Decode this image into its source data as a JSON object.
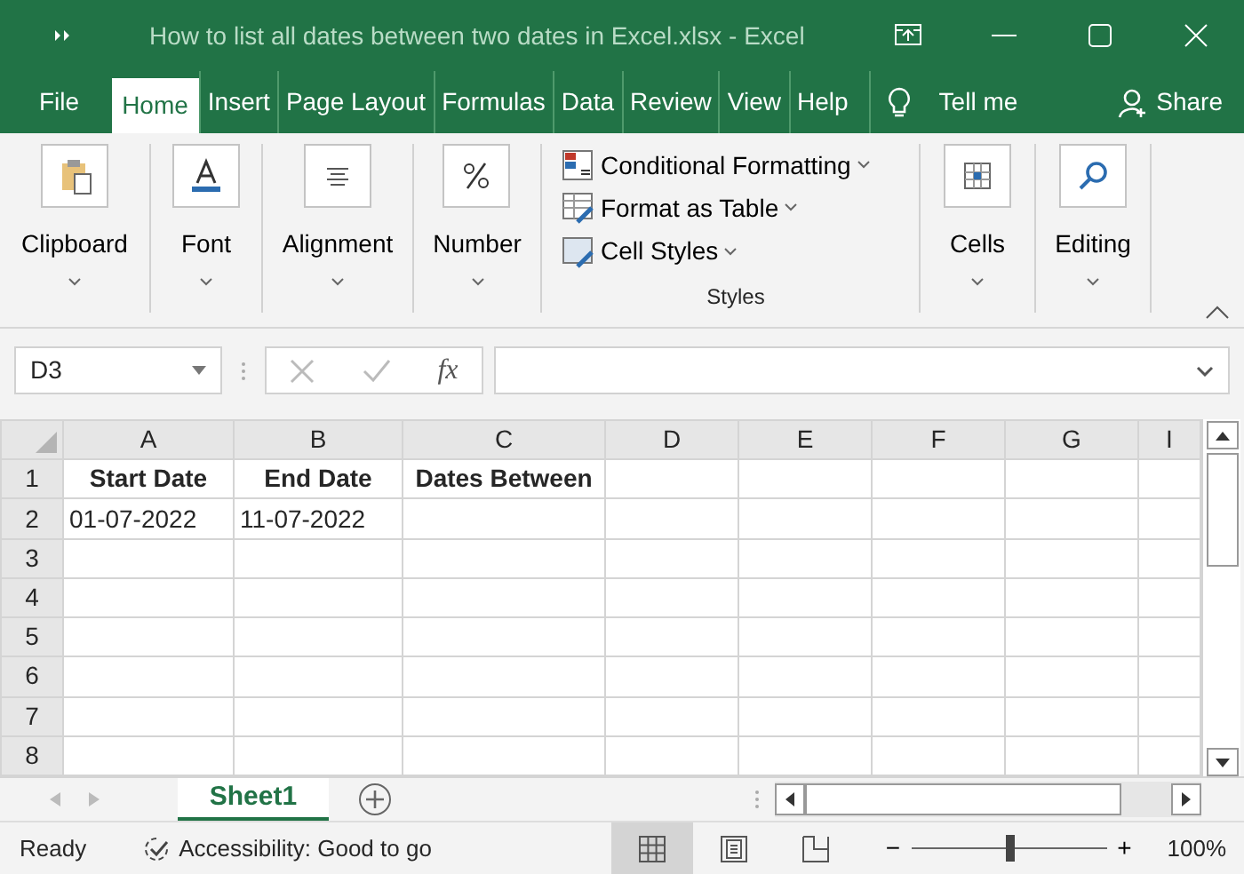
{
  "window": {
    "title": "How to list all dates between two dates in Excel.xlsx  -  Excel"
  },
  "tabs": [
    {
      "label": "File",
      "selected": false
    },
    {
      "label": "Home",
      "selected": true
    },
    {
      "label": "Insert",
      "selected": false
    },
    {
      "label": "Page Layout",
      "selected": false
    },
    {
      "label": "Formulas",
      "selected": false
    },
    {
      "label": "Data",
      "selected": false
    },
    {
      "label": "Review",
      "selected": false
    },
    {
      "label": "View",
      "selected": false
    },
    {
      "label": "Help",
      "selected": false
    }
  ],
  "tell_me": "Tell me",
  "share": "Share",
  "ribbon": [
    {
      "kind": "big",
      "label": "Clipboard"
    },
    {
      "kind": "big",
      "label": "Font"
    },
    {
      "kind": "big",
      "label": "Alignment"
    },
    {
      "kind": "big",
      "label": "Number"
    },
    {
      "kind": "list",
      "label": "Styles",
      "items": [
        {
          "label": "Conditional Formatting"
        },
        {
          "label": "Format as Table"
        },
        {
          "label": "Cell Styles"
        }
      ]
    },
    {
      "kind": "big",
      "label": "Cells"
    },
    {
      "kind": "big",
      "label": "Editing"
    }
  ],
  "formula_bar": {
    "name_box": "D3",
    "fx": "fx"
  },
  "columns": [
    "A",
    "B",
    "C",
    "D",
    "E",
    "F",
    "G",
    "I"
  ],
  "rows": [
    {
      "header": "1",
      "cells": [
        {
          "text": "Start Date",
          "bold": true
        },
        {
          "text": "End Date",
          "bold": true
        },
        {
          "text": "Dates Between",
          "bold": true
        }
      ]
    },
    {
      "header": "2",
      "cells": [
        {
          "text": "01-07-2022",
          "bold": false
        },
        {
          "text": "11-07-2022",
          "bold": false
        }
      ]
    },
    {
      "header": "3"
    },
    {
      "header": "4"
    },
    {
      "header": "5"
    },
    {
      "header": "6"
    },
    {
      "header": "7"
    },
    {
      "header": "8"
    }
  ],
  "sheets": [
    {
      "label": "Sheet1",
      "selected": true
    }
  ],
  "status_bar": {
    "ready": "Ready",
    "accessibility": "Accessibility: Good to go",
    "views": [
      {
        "kind": "normal",
        "selected": true
      },
      {
        "kind": "layout",
        "selected": false
      },
      {
        "kind": "break",
        "selected": false
      }
    ],
    "zoom_minus": "−",
    "zoom_plus": "+",
    "level": 0.5,
    "zoom": "100%"
  }
}
